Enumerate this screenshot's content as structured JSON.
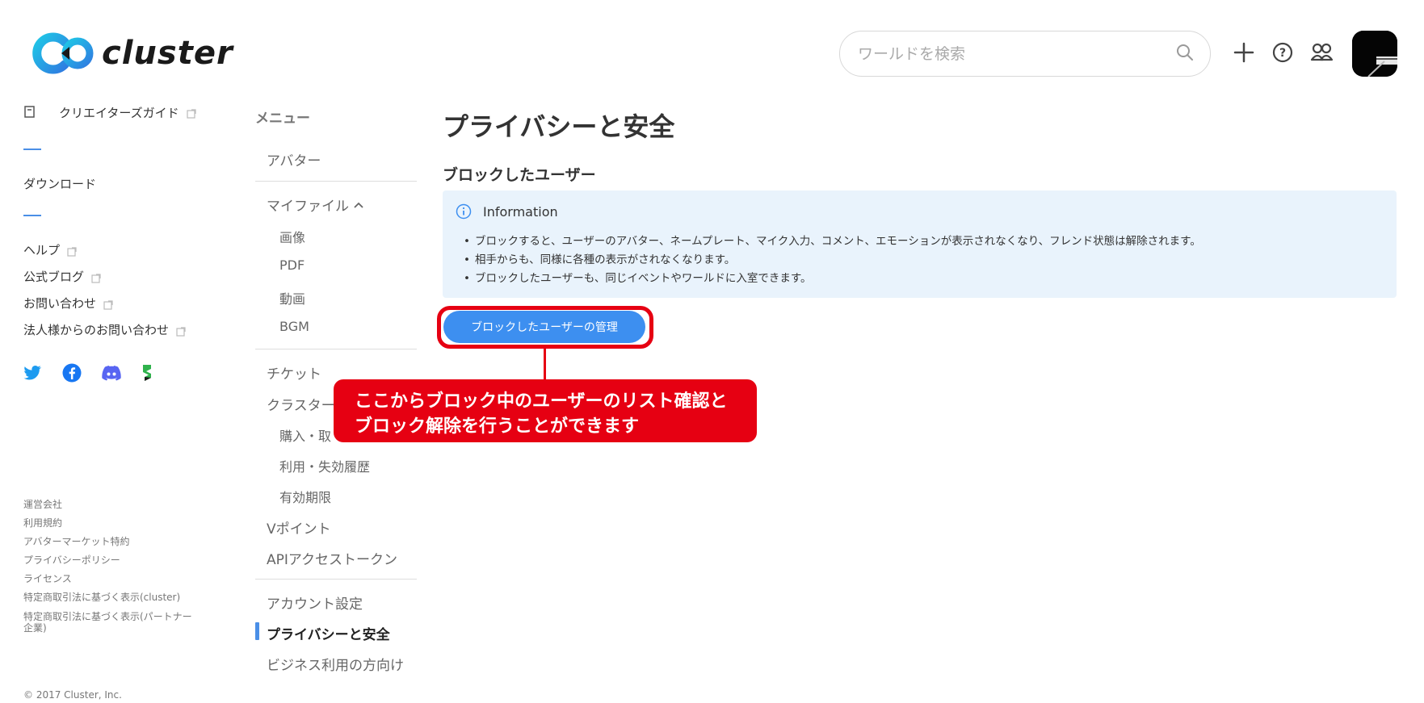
{
  "header": {
    "logo_text": "cluster",
    "search_placeholder": "ワールドを検索",
    "icons": [
      "search-icon",
      "plus-icon",
      "help-icon",
      "friends-icon"
    ]
  },
  "left_nav": {
    "creator_guide": "クリエイターズガイド",
    "download": "ダウンロード",
    "help": "ヘルプ",
    "blog": "公式ブログ",
    "contact": "お問い合わせ",
    "corporate_contact": "法人様からのお問い合わせ",
    "social": [
      "twitter-icon",
      "facebook-icon",
      "discord-icon",
      "store-icon"
    ],
    "footer_links": [
      "運営会社",
      "利用規約",
      "アバターマーケット特約",
      "プライバシーポリシー",
      "ライセンス",
      "特定商取引法に基づく表示(cluster)",
      "特定商取引法に基づく表示(パートナー企業)"
    ],
    "copyright": "© 2017 Cluster, Inc."
  },
  "menu": {
    "heading": "メニュー",
    "avatar": "アバター",
    "my_files": "マイファイル",
    "images": "画像",
    "pdf": "PDF",
    "video": "動画",
    "bgm": "BGM",
    "ticket": "チケット",
    "cluster_item": "クラスター",
    "purchase": "購入・取",
    "usage_history": "利用・失効履歴",
    "expiry": "有効期限",
    "vpoint": "Vポイント",
    "api_token": "APIアクセストークン",
    "account_settings": "アカウント設定",
    "privacy_safety": "プライバシーと安全",
    "business": "ビジネス利用の方向け"
  },
  "main": {
    "page_title": "プライバシーと安全",
    "section_title": "ブロックしたユーザー",
    "info_title": "Information",
    "info_items": [
      "ブロックすると、ユーザーのアバター、ネームプレート、マイク入力、コメント、エモーションが表示されなくなり、フレンド状態は解除されます。",
      "相手からも、同様に各種の表示がされなくなります。",
      "ブロックしたユーザーも、同じイベントやワールドに入室できます。"
    ],
    "manage_button": "ブロックしたユーザーの管理",
    "callout": "ここからブロック中のユーザーのリスト確認と\nブロック解除を行うことができます"
  },
  "colors": {
    "accent": "#3d8ff0",
    "annotation": "#e60012",
    "info_bg": "#e9f3fc"
  }
}
